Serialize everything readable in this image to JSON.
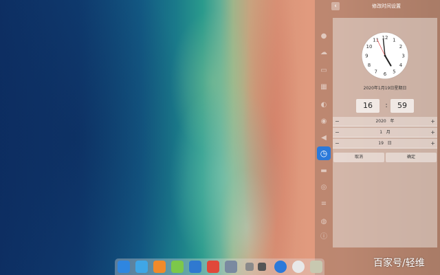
{
  "panel": {
    "title": "修改时间设置",
    "back_icon": "chevron-left-icon"
  },
  "rail_icons": [
    {
      "name": "account-icon",
      "glyph": "●"
    },
    {
      "name": "cloud-icon",
      "glyph": "☁"
    },
    {
      "name": "display-icon",
      "glyph": "▭"
    },
    {
      "name": "default-apps-icon",
      "glyph": "▦"
    },
    {
      "name": "personalization-icon",
      "glyph": "◐"
    },
    {
      "name": "network-icon",
      "glyph": "◉"
    },
    {
      "name": "sound-icon",
      "glyph": "◀"
    },
    {
      "name": "datetime-icon",
      "glyph": "◷",
      "active": true
    },
    {
      "name": "power-icon",
      "glyph": "▬"
    },
    {
      "name": "mouse-icon",
      "glyph": "◎"
    },
    {
      "name": "keyboard-icon",
      "glyph": "≡"
    },
    {
      "name": "update-icon",
      "glyph": "◍"
    },
    {
      "name": "info-icon",
      "glyph": "ⓘ"
    }
  ],
  "clock": {
    "hour": 16,
    "minute": 59,
    "numbers": [
      "12",
      "1",
      "2",
      "3",
      "4",
      "5",
      "6",
      "7",
      "8",
      "9",
      "10",
      "11"
    ]
  },
  "date_text": "2020年1月19日星期日",
  "time": {
    "hour": "16",
    "separator": ":",
    "minute": "59"
  },
  "year": {
    "value": "2020",
    "unit": "年"
  },
  "month": {
    "value": "1",
    "unit": "月"
  },
  "day": {
    "value": "19",
    "unit": "日"
  },
  "stepper": {
    "minus": "−",
    "plus": "+"
  },
  "buttons": {
    "cancel": "取消",
    "confirm": "确定"
  },
  "dock": [
    {
      "name": "launcher-icon",
      "color": "#2f86e0"
    },
    {
      "name": "file-manager-icon",
      "color": "#3fa6e6"
    },
    {
      "name": "app-store-icon",
      "color": "#f08a2a"
    },
    {
      "name": "music-icon",
      "color": "#7cc84a"
    },
    {
      "name": "video-icon",
      "color": "#2f79d0"
    },
    {
      "name": "chrome-icon",
      "color": "#e0483a"
    },
    {
      "name": "settings-icon",
      "color": "#7a8aa0"
    },
    {
      "name": "show-desktop-icon",
      "color": "#8a8a8a"
    },
    {
      "name": "terminal-icon",
      "color": "#555555"
    },
    {
      "name": "shutdown-icon",
      "color": "#2c79d9"
    },
    {
      "name": "clock-applet-icon",
      "color": "#e8e8e8"
    },
    {
      "name": "trash-icon",
      "color": "#c8c8b0"
    }
  ],
  "watermark": "百家号/轻维"
}
